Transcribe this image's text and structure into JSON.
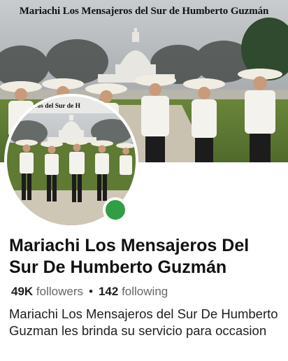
{
  "cover": {
    "banner_text": "Mariachi Los Mensajeros del Sur de Humberto Guzmán"
  },
  "avatar": {
    "banner_text": "ensajeros del Sur de H",
    "status": "online"
  },
  "profile": {
    "name": "Mariachi Los Mensajeros Del Sur De Humberto Guzmán",
    "followers_count": "49K",
    "followers_label": "followers",
    "separator": "•",
    "following_count": "142",
    "following_label": "following",
    "bio": "Mariachi Los Mensajeros del Sur De Humberto Guzman les brinda su servicio para occasion"
  },
  "colors": {
    "status_online": "#2f9e44",
    "secondary_text": "#65676b",
    "primary_text": "#1c1e21"
  }
}
